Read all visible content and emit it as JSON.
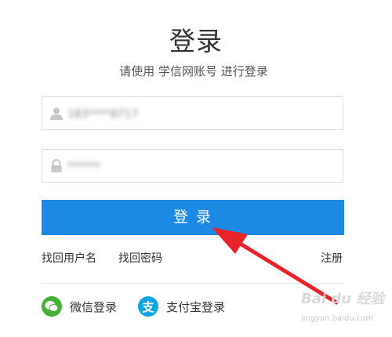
{
  "header": {
    "title": "登录",
    "subtitle": "请使用 学信网账号 进行登录"
  },
  "form": {
    "username": {
      "value": "183****8717",
      "icon": "user-icon"
    },
    "password": {
      "value": "******",
      "icon": "lock-icon"
    },
    "login_label": "登 录"
  },
  "links": {
    "retrieve_username": "找回用户名",
    "retrieve_password": "找回密码",
    "register": "注册"
  },
  "social": {
    "wechat_label": "微信登录",
    "alipay_label": "支付宝登录",
    "alipay_glyph": "支"
  },
  "colors": {
    "primary": "#1e88e5",
    "wechat": "#45b035",
    "alipay": "#10a5e6",
    "annotation_arrow": "#e8232a"
  },
  "watermark": {
    "brand": "Bai du 经验",
    "url": "jingyan.baidu.com"
  }
}
